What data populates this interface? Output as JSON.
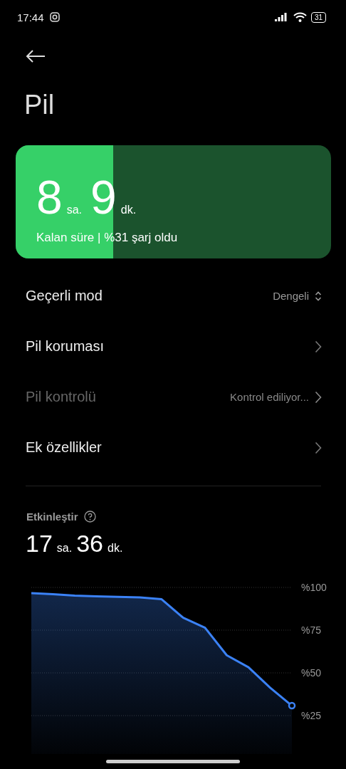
{
  "status_bar": {
    "time": "17:44",
    "battery": "31"
  },
  "title": "Pil",
  "battery_card": {
    "level": 0.31,
    "hours": "8",
    "hours_unit": "sa.",
    "minutes": "9",
    "minutes_unit": "dk.",
    "caption": "Kalan süre | %31 şarj oldu"
  },
  "settings": [
    {
      "kind": "selector",
      "label": "Geçerli mod",
      "value": "Dengeli",
      "disabled": false
    },
    {
      "kind": "link",
      "label": "Pil koruması",
      "disabled": false
    },
    {
      "kind": "link",
      "label": "Pil kontrolü",
      "value": "Kontrol ediliyor...",
      "disabled": true
    },
    {
      "kind": "link",
      "label": "Ek özellikler",
      "disabled": false
    }
  ],
  "usage": {
    "label": "Etkinleştir",
    "hours": "17",
    "hours_unit": "sa.",
    "minutes": "36",
    "minutes_unit": "dk.",
    "chart_data": {
      "type": "area",
      "categories": [
        null,
        null,
        null,
        null,
        null,
        null,
        null,
        null,
        null,
        null,
        null,
        null,
        null
      ],
      "grid": true,
      "series": [
        {
          "color": "#3b82f6",
          "values": [
            96.7,
            96.0,
            95.2,
            94.8,
            94.5,
            94.2,
            93.1,
            82.2,
            76.4,
            60.3,
            53.3,
            41.3,
            30.8
          ]
        }
      ],
      "ylim": [
        0,
        100
      ],
      "yticks": [
        {
          "value": 100,
          "label": "%100"
        },
        {
          "value": 75,
          "label": "%75"
        },
        {
          "value": 50,
          "label": "%50"
        },
        {
          "value": 25,
          "label": "%25"
        }
      ]
    }
  }
}
